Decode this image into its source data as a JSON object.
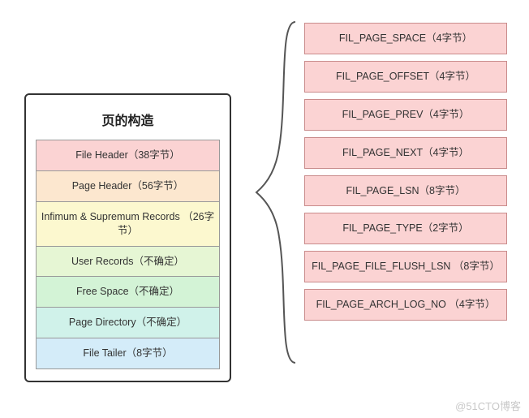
{
  "left": {
    "title": "页的构造",
    "rows": [
      {
        "label": "File Header（38字节）",
        "color": "c-red"
      },
      {
        "label": "Page Header（56字节）",
        "color": "c-orange"
      },
      {
        "label": "Infimum & Supremum Records\n（26字节）",
        "color": "c-yellow"
      },
      {
        "label": "User Records（不确定）",
        "color": "c-lime"
      },
      {
        "label": "Free Space（不确定）",
        "color": "c-green"
      },
      {
        "label": "Page Directory（不确定）",
        "color": "c-teal"
      },
      {
        "label": "File Tailer（8字节）",
        "color": "c-blue"
      }
    ]
  },
  "right": {
    "rows": [
      "FIL_PAGE_SPACE（4字节）",
      "FIL_PAGE_OFFSET（4字节）",
      "FIL_PAGE_PREV（4字节）",
      "FIL_PAGE_NEXT（4字节）",
      "FIL_PAGE_LSN（8字节）",
      "FIL_PAGE_TYPE（2字节）",
      "FIL_PAGE_FILE_FLUSH_LSN\n（8字节）",
      "FIL_PAGE_ARCH_LOG_NO\n（4字节）"
    ]
  },
  "watermark": "@51CTO博客"
}
